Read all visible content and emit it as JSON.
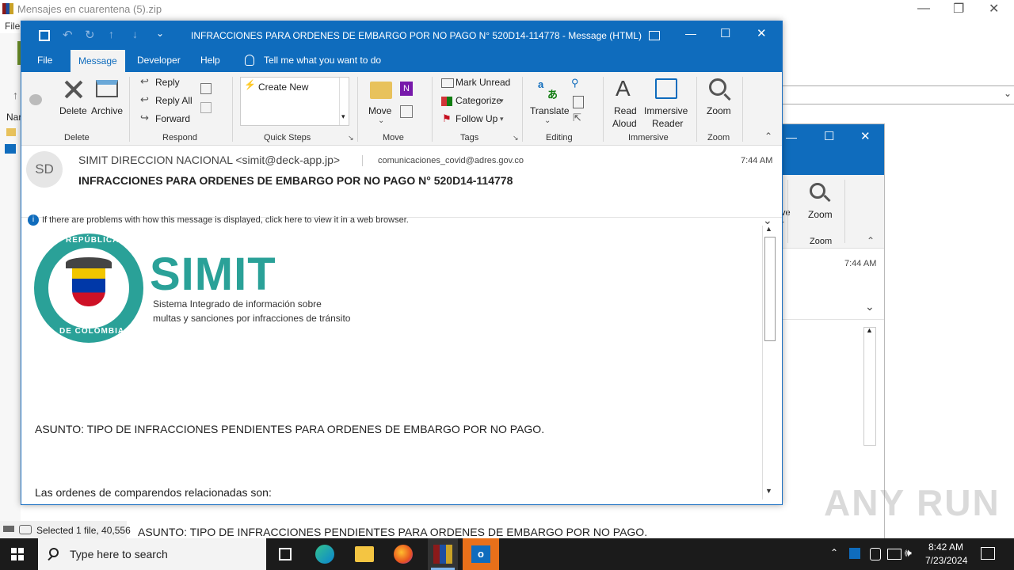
{
  "background_window": {
    "title": "Mensajes en cuarentena (5).zip",
    "menu_file": "File",
    "status": "Selected 1 file, 40,556",
    "nav_label": "Nar",
    "bottom_subject": "ASUNTO: TIPO  DE INFRACCIONES  PENDIENTES   PARA ORDENES DE EMBARGO POR NO PAGO."
  },
  "mail_window": {
    "title": "INFRACCIONES PARA ORDENES DE EMBARGO POR NO PAGO N° 520D14-114778  -  Message (HTML)",
    "tabs": [
      "File",
      "Message",
      "Developer",
      "Help"
    ],
    "tell_me": "Tell me what you want to do",
    "ribbon": {
      "delete_group": "Delete",
      "delete_btn": "Delete",
      "archive_btn": "Archive",
      "respond_group": "Respond",
      "reply": "Reply",
      "reply_all": "Reply All",
      "forward": "Forward",
      "quicksteps_group": "Quick Steps",
      "create_new": "Create New",
      "move_group": "Move",
      "move_btn": "Move",
      "tags_group": "Tags",
      "mark_unread": "Mark Unread",
      "categorize": "Categorize",
      "follow_up": "Follow Up",
      "editing_group": "Editing",
      "translate": "Translate",
      "immersive_group": "Immersive",
      "read_aloud_1": "Read",
      "read_aloud_2": "Aloud",
      "immersive_reader_1": "Immersive",
      "immersive_reader_2": "Reader",
      "zoom_group": "Zoom",
      "zoom_btn": "Zoom"
    },
    "header": {
      "avatar_initials": "SD",
      "from": "SIMIT DIRECCION NACIONAL <simit@deck-app.jp>",
      "to": "comunicaciones_covid@adres.gov.co",
      "time": "7:44 AM",
      "subject": "INFRACCIONES PARA ORDENES DE EMBARGO POR NO PAGO N° 520D14-114778",
      "info_bar": "If there are problems with how this message is displayed, click here to view it in a web browser."
    },
    "body": {
      "seal_top": "REPÚBLICA",
      "seal_bottom": "DE COLOMBIA",
      "logo_title": "SIMIT",
      "logo_line1": "Sistema Integrado de información sobre",
      "logo_line2": "multas y sanciones por infracciones de tránsito",
      "subject_line": "ASUNTO: TIPO  DE INFRACCIONES  PENDIENTES   PARA ORDENES DE EMBARGO POR NO PAGO.",
      "orders_line": "Las ordenes de comparendos relacionadas son:"
    }
  },
  "second_window": {
    "zoom_btn": "Zoom",
    "zoom_group": "Zoom",
    "time": "7:44 AM",
    "partial_label_1": "ve",
    "partial_label_2": "r"
  },
  "taskbar": {
    "search_placeholder": "Type here to search",
    "clock_time": "8:42 AM",
    "clock_date": "7/23/2024"
  },
  "watermark": "ANY RUN",
  "colors": {
    "outlook_blue": "#0f6cbd",
    "simit_teal": "#2aa198",
    "taskbar": "#1b1b1b"
  }
}
